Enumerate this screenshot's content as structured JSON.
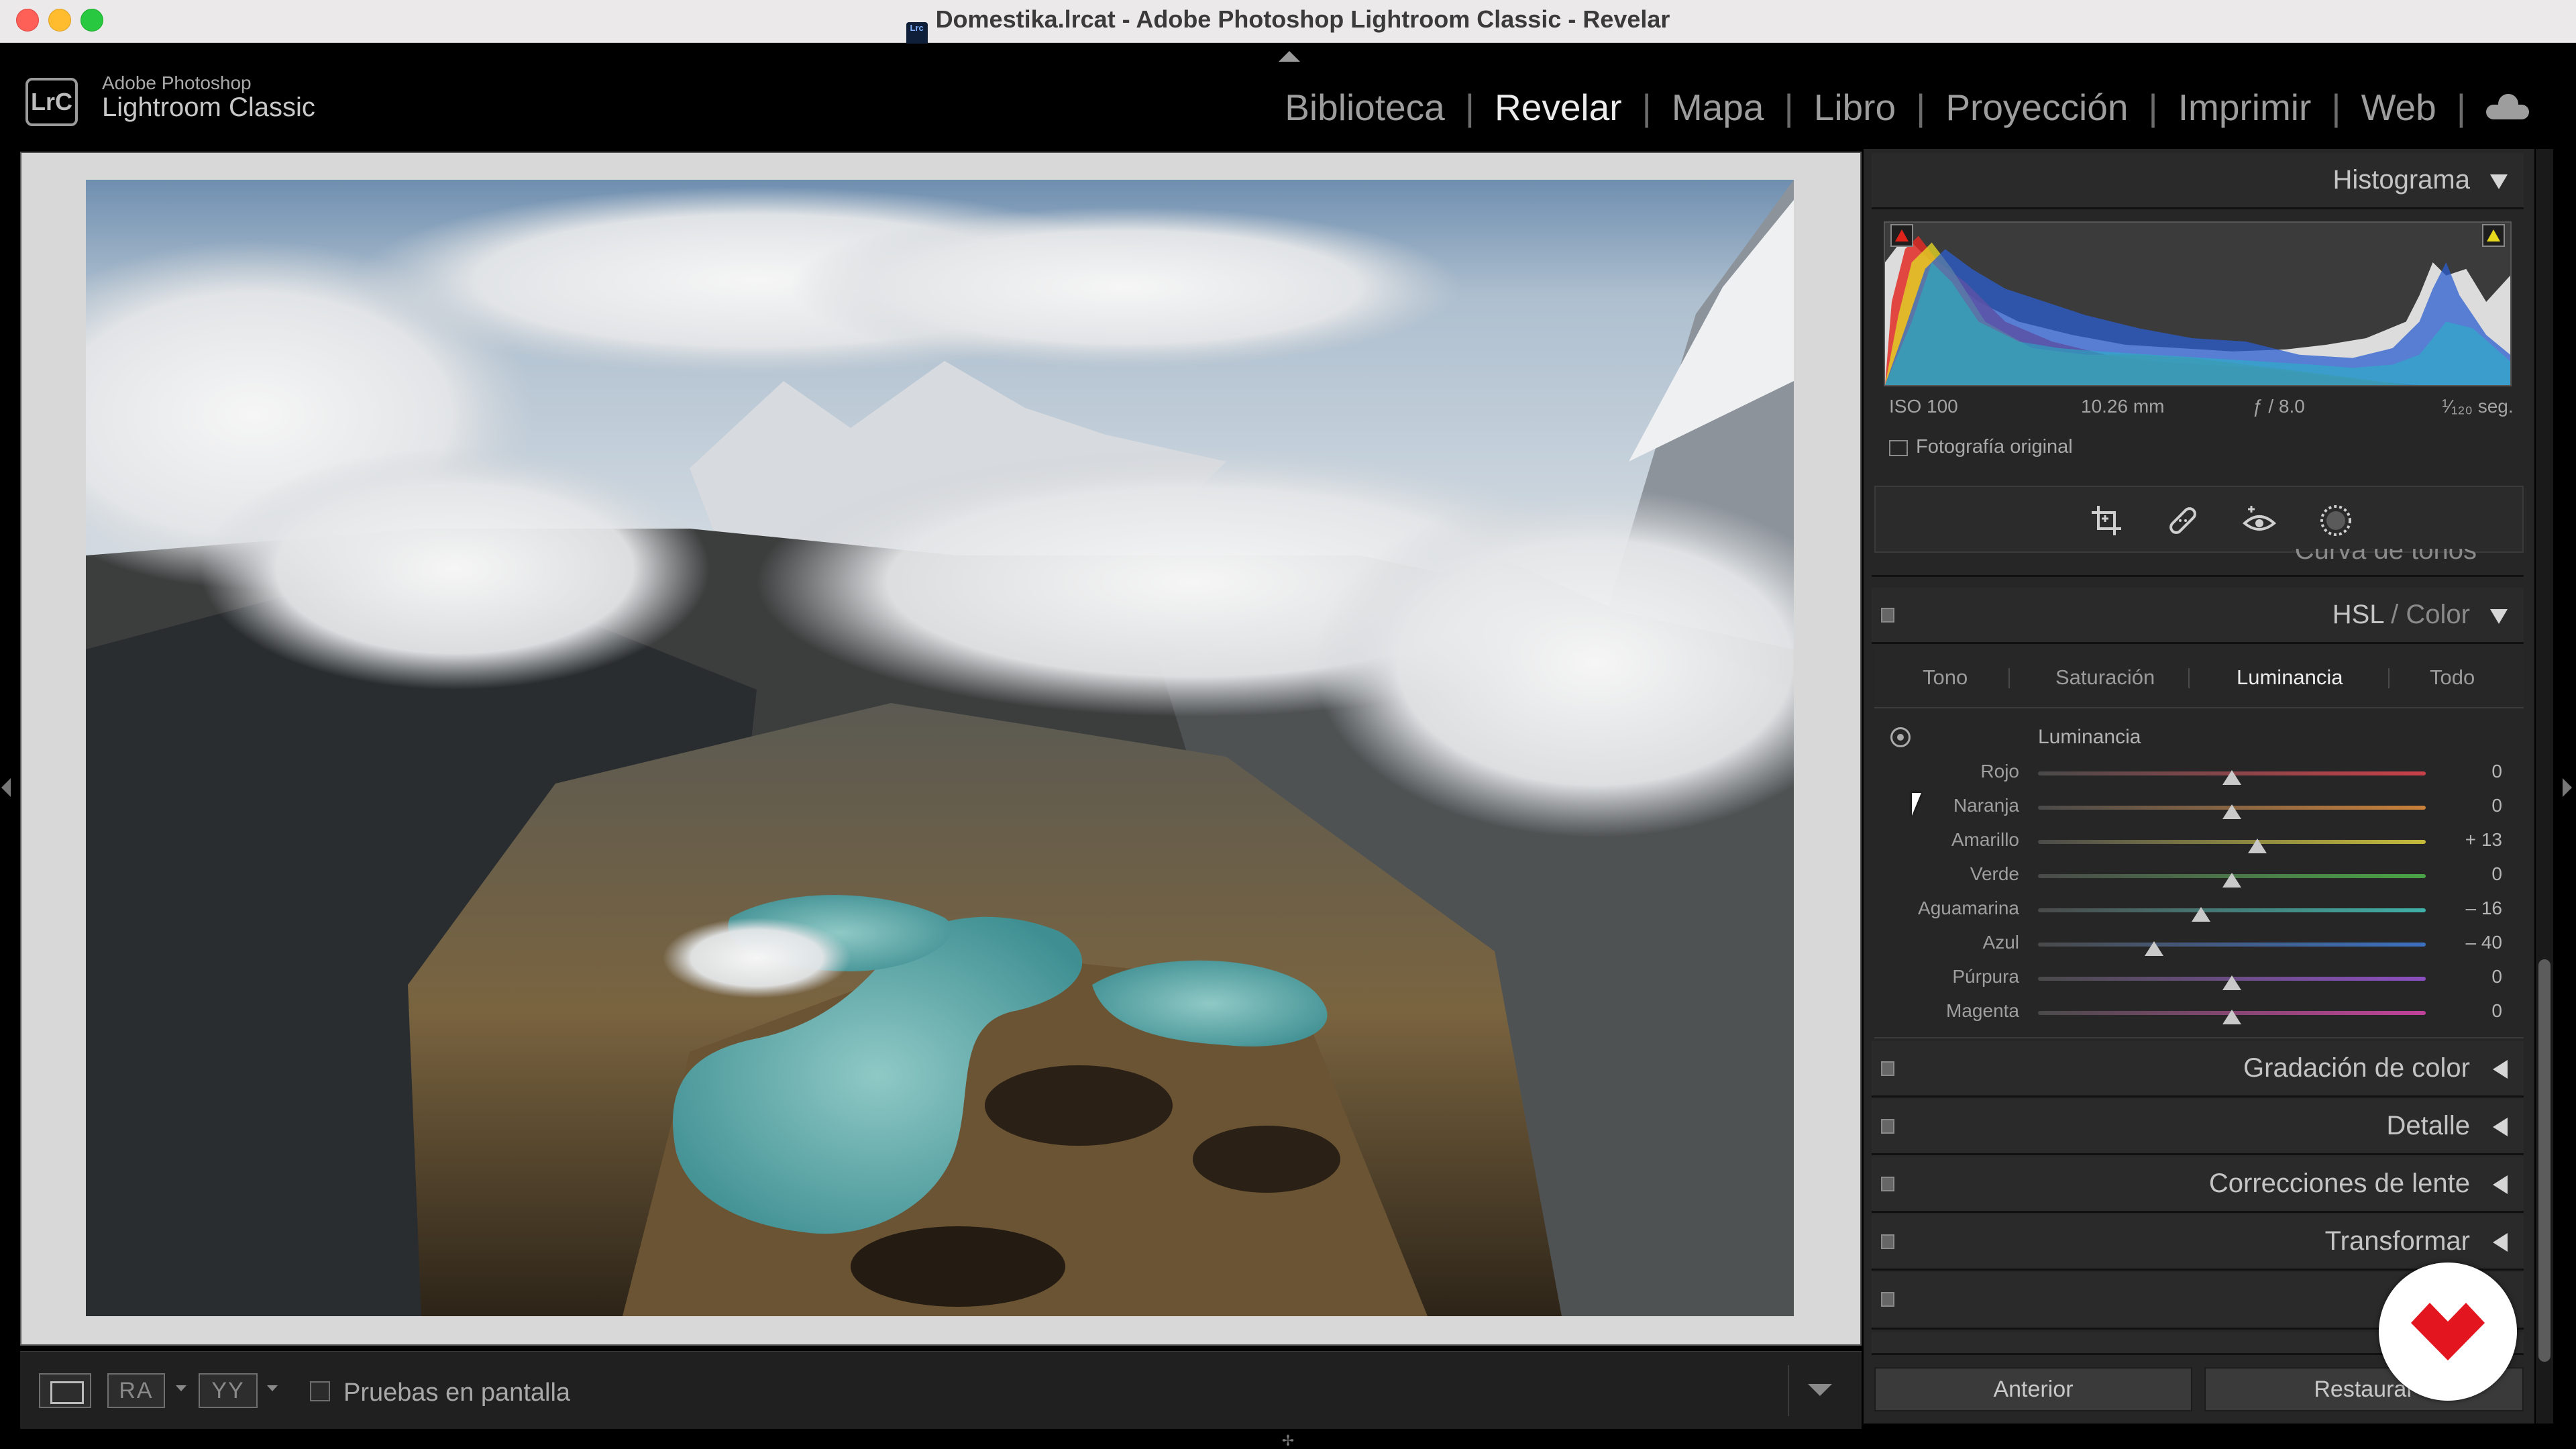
{
  "window": {
    "title": "Domestika.lrcat - Adobe Photoshop Lightroom Classic - Revelar",
    "app_icon": "Lrc"
  },
  "brand": {
    "badge": "LrC",
    "sub": "Adobe Photoshop",
    "main": "Lightroom Classic"
  },
  "modules": {
    "items": [
      "Biblioteca",
      "Revelar",
      "Mapa",
      "Libro",
      "Proyección",
      "Imprimir",
      "Web"
    ],
    "active": "Revelar",
    "cloud_icon": "cloud-icon"
  },
  "toolbar": {
    "view_icon": "loupe-view-icon",
    "ra_label": "RA",
    "yy_label": "YY",
    "softproof_label": "Pruebas en pantalla",
    "softproof_checked": false
  },
  "histogram": {
    "title": "Histograma",
    "iso": "ISO 100",
    "focal": "10.26 mm",
    "aperture": "ƒ / 8.0",
    "shutter": "¹⁄₁₂₀ seg.",
    "original_label": "Fotografía original",
    "clip_shadow_color": "#e0231b",
    "clip_highlight_color": "#e5d81d"
  },
  "tools": [
    "crop-icon",
    "healing-brush-icon",
    "red-eye-icon",
    "mask-icon"
  ],
  "curve_peek": "Curva de tonos",
  "hsl": {
    "title_main": "HSL",
    "title_sep": " / ",
    "title_alt": "Color",
    "tabs": [
      "Tono",
      "Saturación",
      "Luminancia",
      "Todo"
    ],
    "active_tab": "Luminancia",
    "section_title": "Luminancia",
    "rows": [
      {
        "label": "Rojo",
        "value": 0,
        "display": "0",
        "color": "#c8404a"
      },
      {
        "label": "Naranja",
        "value": 0,
        "display": "0",
        "color": "#c9803a"
      },
      {
        "label": "Amarillo",
        "value": 13,
        "display": "+ 13",
        "color": "#c6bb3a"
      },
      {
        "label": "Verde",
        "value": 0,
        "display": "0",
        "color": "#4aa346"
      },
      {
        "label": "Aguamarina",
        "value": -16,
        "display": "– 16",
        "color": "#3fb0a8"
      },
      {
        "label": "Azul",
        "value": -40,
        "display": "– 40",
        "color": "#3c6fc2"
      },
      {
        "label": "Púrpura",
        "value": 0,
        "display": "0",
        "color": "#8c4fc0"
      },
      {
        "label": "Magenta",
        "value": 0,
        "display": "0",
        "color": "#c0429a"
      }
    ]
  },
  "collapsed_panels": [
    "Gradación de color",
    "Detalle",
    "Correcciones de lente",
    "Transformar"
  ],
  "buttons": {
    "previous": "Anterior",
    "reset": "Restaurar"
  }
}
